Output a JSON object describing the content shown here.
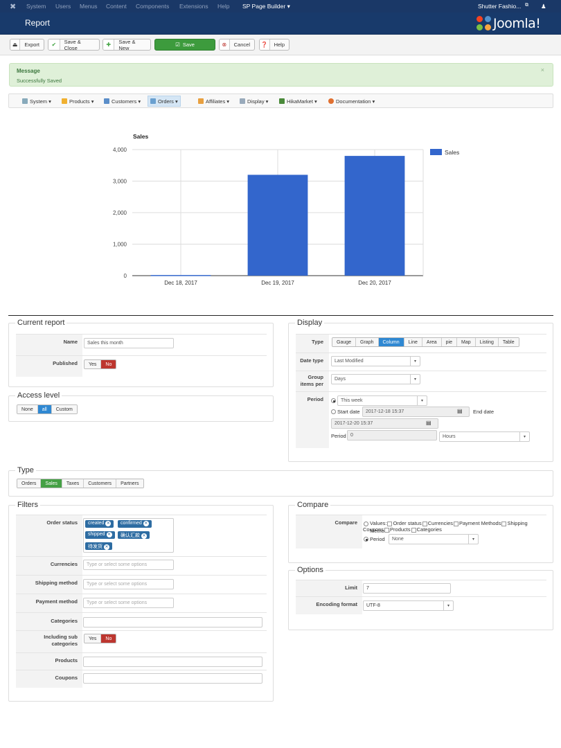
{
  "topbar": {
    "menus": [
      "System",
      "Users",
      "Menus",
      "Content",
      "Components",
      "Extensions",
      "Help"
    ],
    "spb": "SP Page Builder ▾",
    "site": "Shutter Fashio...",
    "site_icon": "external-link-icon",
    "user_icon": "user-icon"
  },
  "header": {
    "title": "Report",
    "logo": "Joomla!"
  },
  "toolbar": {
    "export": "Export",
    "save_close": "Save & Close",
    "save_new": "Save & New",
    "save": "Save",
    "cancel": "Cancel",
    "help": "Help"
  },
  "message": {
    "heading": "Message",
    "text": "Successfully Saved",
    "close": "×"
  },
  "menubar": [
    "System",
    "Products",
    "Customers",
    "Orders",
    "Affiliates",
    "Display",
    "HikaMarket",
    "Documentation"
  ],
  "chart_data": {
    "type": "bar",
    "title": "Sales",
    "categories": [
      "Dec 18, 2017",
      "Dec 19, 2017",
      "Dec 20, 2017"
    ],
    "series": [
      {
        "name": "Sales",
        "values": [
          20,
          3200,
          3800
        ]
      }
    ],
    "ylim": [
      0,
      4000
    ],
    "yticks": [
      0,
      1000,
      2000,
      3000,
      4000
    ],
    "ytick_labels": [
      "0",
      "1,000",
      "2,000",
      "3,000",
      "4,000"
    ],
    "legend": "right",
    "grid": true,
    "color": "#3366cc"
  },
  "current_report": {
    "legend": "Current report",
    "name_label": "Name",
    "name_value": "Sales this month",
    "published_label": "Published",
    "yes": "Yes",
    "no": "No"
  },
  "access_level": {
    "legend": "Access level",
    "options": [
      "None",
      "all",
      "Custom"
    ],
    "selected": "all"
  },
  "display": {
    "legend": "Display",
    "type_label": "Type",
    "types": [
      "Gauge",
      "Graph",
      "Column",
      "Line",
      "Area",
      "pie",
      "Map",
      "Listing",
      "Table"
    ],
    "type_selected": "Column",
    "date_type_label": "Date type",
    "date_type_value": "Last Modified",
    "group_label": "Group items per",
    "group_value": "Days",
    "period_label": "Period",
    "period_value": "This week",
    "start_date_label": "Start date",
    "start_date": "2017-12-18 15:37",
    "end_date_label": "End date",
    "end_date": "2017-12-20 15:37",
    "period2_label": "Period",
    "period2_value": "0",
    "period2_unit": "Hours"
  },
  "type_section": {
    "legend": "Type",
    "options": [
      "Orders",
      "Sales",
      "Taxes",
      "Customers",
      "Partners"
    ],
    "selected": "Sales"
  },
  "filters": {
    "legend": "Filters",
    "order_status_label": "Order status",
    "order_status_tags": [
      "created",
      "confirmed",
      "shipped",
      "确认汇款",
      "待发货"
    ],
    "currencies_label": "Currencies",
    "shipping_label": "Shipping method",
    "payment_label": "Payment method",
    "placeholder": "Type or select some options",
    "categories_label": "Categories",
    "including_label": "Including sub categories",
    "yes": "Yes",
    "no": "No",
    "products_label": "Products",
    "coupons_label": "Coupons"
  },
  "compare": {
    "legend": "Compare",
    "label": "Compare",
    "values_label": "Values:",
    "value_options": [
      "Order status",
      "Currencies",
      "Payment Methods",
      "Shipping Methods",
      "Coupons",
      "Products",
      "Categories"
    ],
    "period_label": "Period",
    "period_value": "None"
  },
  "options": {
    "legend": "Options",
    "limit_label": "Limit",
    "limit_value": "7",
    "encoding_label": "Encoding format",
    "encoding_value": "UTF-8"
  }
}
